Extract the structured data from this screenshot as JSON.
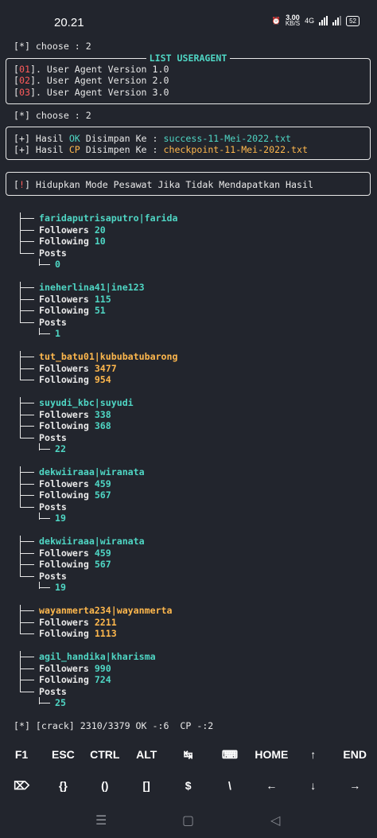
{
  "statusbar": {
    "time": "20.21",
    "speed_value": "3.00",
    "speed_unit": "KB/S",
    "network": "4G",
    "battery": "52"
  },
  "prompt1": "[*] choose : 2",
  "useragent_box": {
    "title": "LIST USERAGENT",
    "items": [
      {
        "num": "01",
        "label": ". User Agent Version 1.0"
      },
      {
        "num": "02",
        "label": ". User Agent Version 2.0"
      },
      {
        "num": "03",
        "label": ". User Agent Version 3.0"
      }
    ]
  },
  "prompt2": "[*] choose : 2",
  "result_box": {
    "ok_prefix": "[+] Hasil ",
    "ok_tag": "OK",
    "ok_mid": " Disimpan Ke : ",
    "ok_file": "success-11-Mei-2022.txt",
    "cp_prefix": "[+] Hasil ",
    "cp_tag": "CP",
    "cp_mid": " Disimpen Ke : ",
    "cp_file": "checkpoint-11-Mei-2022.txt"
  },
  "warning_box": {
    "open": "[",
    "mark": "!",
    "close": "] ",
    "text": "Hidupkan Mode Pesawat Jika Tidak Mendapatkan Hasil"
  },
  "accounts": [
    {
      "name": "faridaputrisaputro|farida",
      "status": "ok",
      "followers": "20",
      "following": "10",
      "posts": "0"
    },
    {
      "name": "ineherlina41|ine123",
      "status": "ok",
      "followers": "115",
      "following": "51",
      "posts": "1"
    },
    {
      "name": "tut_batu01|kububatubarong",
      "status": "cp",
      "followers": "3477",
      "following": "954",
      "posts": null
    },
    {
      "name": "suyudi_kbc|suyudi",
      "status": "ok",
      "followers": "338",
      "following": "368",
      "posts": "22"
    },
    {
      "name": "dekwiiraaa|wiranata",
      "status": "ok",
      "followers": "459",
      "following": "567",
      "posts": "19"
    },
    {
      "name": "dekwiiraaa|wiranata",
      "status": "ok",
      "followers": "459",
      "following": "567",
      "posts": "19"
    },
    {
      "name": "wayanmerta234|wayanmerta",
      "status": "cp",
      "followers": "2211",
      "following": "1113",
      "posts": null
    },
    {
      "name": "agil_handika|kharisma",
      "status": "ok",
      "followers": "990",
      "following": "724",
      "posts": "25"
    }
  ],
  "labels": {
    "followers": "Followers ",
    "following": "Following ",
    "posts": "Posts"
  },
  "crack_status": "[*] [crack] 2310/3379 OK -:6  CP -:2",
  "extra_keys": {
    "row1": [
      "F1",
      "ESC",
      "CTRL",
      "ALT",
      "↹",
      "⌨",
      "HOME",
      "↑",
      "END"
    ],
    "row2": [
      "⌦",
      "{}",
      "()",
      "[]",
      "$",
      "\\",
      "←",
      "↓",
      "→"
    ]
  },
  "nav": {
    "menu": "☰",
    "home": "▢",
    "back": "◁"
  },
  "colors": {
    "ok": "#4fd6c4",
    "cp": "#ffb84d",
    "bracket_red": "#ff5c5c",
    "bg": "#22252d"
  }
}
